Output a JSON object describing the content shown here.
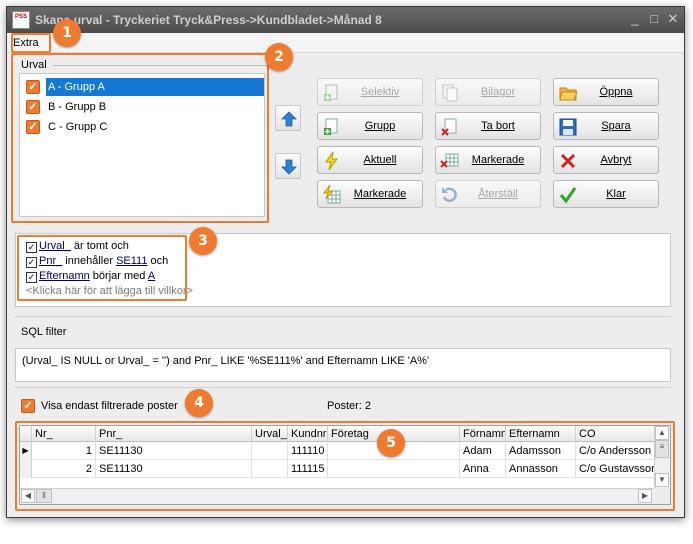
{
  "window": {
    "title": "Skapa urval - Tryckeriet Tryck&Press->Kundbladet->Månad 8",
    "icon_text": "PSS",
    "controls": [
      "minimize-icon",
      "maximize-icon",
      "close-icon"
    ]
  },
  "menu": {
    "extra": "Extra"
  },
  "markers": [
    "1",
    "2",
    "3",
    "4",
    "5"
  ],
  "urval": {
    "group_label": "Urval",
    "items": [
      {
        "label": "A - Grupp A",
        "checked": true,
        "selected": true
      },
      {
        "label": "B - Grupp B",
        "checked": true,
        "selected": false
      },
      {
        "label": "C - Grupp C",
        "checked": true,
        "selected": false
      }
    ]
  },
  "buttons": {
    "selektiv": "Selektiv",
    "bilagor": "Bilagor",
    "oppna": "Öppna",
    "grupp": "Grupp",
    "ta_bort": "Ta bort",
    "spara": "Spara",
    "aktuell": "Aktuell",
    "markerade_top": "Markerade",
    "avbryt": "Avbryt",
    "markerade_bottom": "Markerade",
    "aterstall": "Återställ",
    "klar": "Klar"
  },
  "conditions": [
    {
      "field": "Urval_",
      "op": " är tomt och",
      "value": ""
    },
    {
      "field": "Pnr_",
      "op": " innehåller ",
      "value": "SE111",
      "tail": " och"
    },
    {
      "field": "Efternamn",
      "op": " börjar med ",
      "value": "A",
      "tail": ""
    }
  ],
  "add_condition_hint": "<Klicka här för att lägga till villkor>",
  "sql": {
    "label": "SQL filter",
    "text": "(Urval_ IS NULL or Urval_ = '') and Pnr_ LIKE '%SE111%' and Efternamn LIKE 'A%'"
  },
  "show_filtered": {
    "label": "Visa endast filtrerade poster",
    "checked": true
  },
  "post_count": "Poster: 2",
  "grid": {
    "columns": [
      "Nr_",
      "Pnr_",
      "Urval_",
      "Kundnr",
      "Företag",
      "Förnamn",
      "Efternamn",
      "CO"
    ],
    "rows": [
      [
        "1",
        "SE11130",
        "",
        "111110",
        "",
        "Adam",
        "Adamsson",
        "C/o Andersson"
      ],
      [
        "2",
        "SE11130",
        "",
        "111115",
        "",
        "Anna",
        "Annasson",
        "C/o Gustavsson"
      ]
    ]
  },
  "colors": {
    "accent": "#f07a30",
    "selection": "#1478d4",
    "titlebar": "#4c4c4c"
  }
}
